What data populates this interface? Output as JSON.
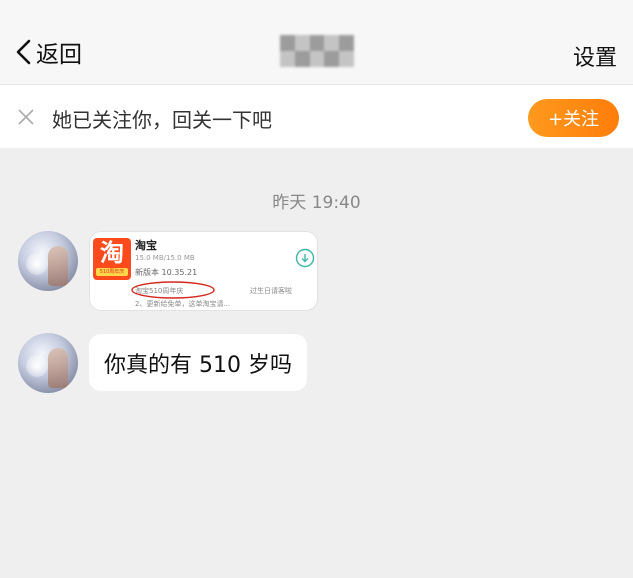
{
  "nav": {
    "back_label": "返回",
    "settings_label": "设置"
  },
  "follow_bar": {
    "message": "她已关注你，回关一下吧",
    "button_label": "+关注"
  },
  "timestamp": "昨天 19:40",
  "messages": [
    {
      "type": "app-card",
      "app_name": "淘宝",
      "icon_glyph": "淘",
      "icon_tag": "510周年庆",
      "size": "15.0 MB/15.0 MB",
      "version": "新版本 10.35.21",
      "note_part1": "淘宝510周年庆",
      "note_part2": "过生日请客啦",
      "note_line2": "2、更新给免单，这单淘宝请..."
    },
    {
      "type": "text",
      "text": "你真的有 510 岁吗"
    }
  ],
  "colors": {
    "accent": "#ff8a12",
    "page_bg": "#efefef",
    "annotation": "#d2281f",
    "download": "#3cb7a8"
  }
}
